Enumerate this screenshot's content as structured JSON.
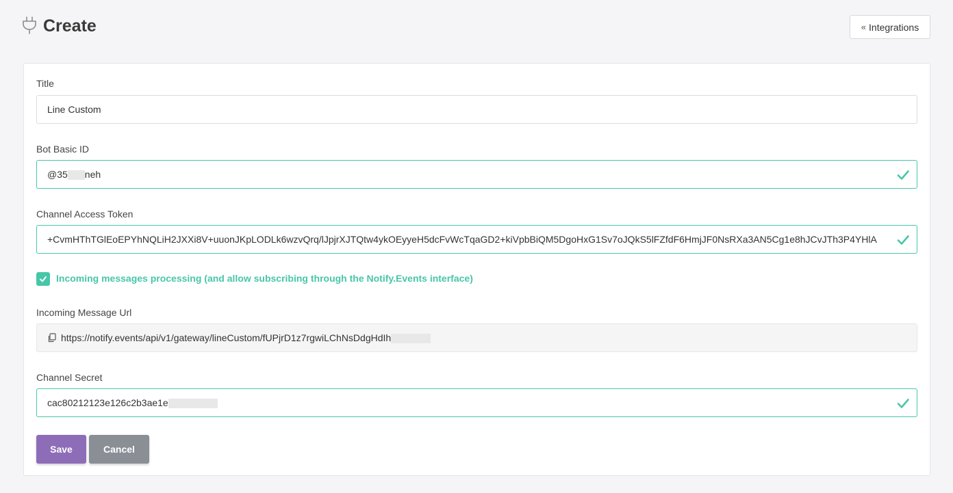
{
  "header": {
    "title": "Create",
    "integrations_label": "Integrations"
  },
  "form": {
    "title_label": "Title",
    "title_value": "Line Custom",
    "bot_id_label": "Bot Basic ID",
    "bot_id_value_start": "@35",
    "bot_id_value_end": "neh",
    "token_label": "Channel Access Token",
    "token_value": "+CvmHThTGlEoEPYhNQLiH2JXXi8V+uuonJKpLODLk6wzvQrq/lJpjrXJTQtw4ykOEyyeH5dcFvWcTqaGD2+kiVpbBiQM5DgoHxG1Sv7oJQkS5lFZfdF6HmjJF0NsRXa3AN5Cg1e8hJCvJTh3P4YHlA",
    "incoming_checkbox_label": "Incoming messages processing (and allow subscribing through the Notify.Events interface)",
    "incoming_url_label": "Incoming Message Url",
    "incoming_url_value": "https://notify.events/api/v1/gateway/lineCustom/fUPjrD1z7rgwiLChNsDdgHdIh",
    "secret_label": "Channel Secret",
    "secret_value": "cac80212123e126c2b3ae1e",
    "save_label": "Save",
    "cancel_label": "Cancel"
  },
  "colors": {
    "accent_green": "#47c6a9",
    "save_purple": "#8e6db8",
    "cancel_gray": "#8a8f96"
  },
  "icons": [
    "plug-icon",
    "chevron-double-left-icon",
    "check-icon",
    "copy-icon"
  ]
}
